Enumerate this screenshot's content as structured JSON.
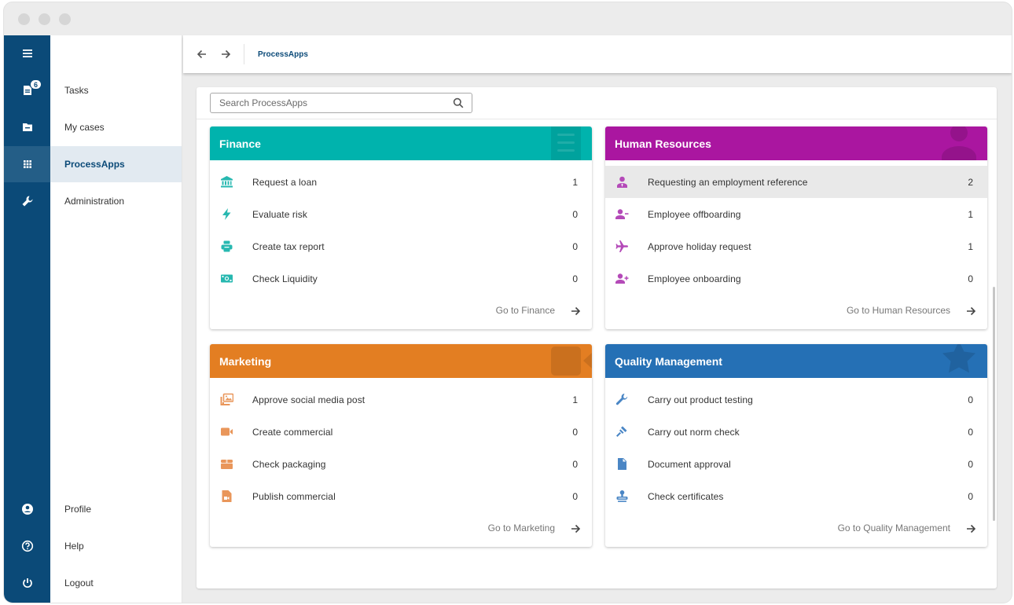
{
  "window": {
    "controls": [
      "close",
      "minimize",
      "maximize"
    ]
  },
  "rail": {
    "menu_icon": "hamburger-icon",
    "tasks_badge": "6",
    "items": [
      {
        "name": "tasks",
        "icon": "task-list-icon"
      },
      {
        "name": "my-cases",
        "icon": "folder-icon"
      },
      {
        "name": "processapps",
        "icon": "apps-grid-icon",
        "active": true
      },
      {
        "name": "administration",
        "icon": "wrench-icon"
      },
      {
        "name": "profile",
        "icon": "account-circle-icon"
      },
      {
        "name": "help",
        "icon": "help-circle-icon"
      },
      {
        "name": "logout",
        "icon": "power-icon"
      }
    ]
  },
  "nav": {
    "tasks": "Tasks",
    "my_cases": "My cases",
    "processapps": "ProcessApps",
    "administration": "Administration",
    "profile": "Profile",
    "help": "Help",
    "logout": "Logout"
  },
  "topbar": {
    "back_icon": "arrow-left-icon",
    "forward_icon": "arrow-right-icon",
    "title": "ProcessApps"
  },
  "search": {
    "placeholder": "Search ProcessApps",
    "value": ""
  },
  "cards": [
    {
      "title": "Finance",
      "color": "#00b3ad",
      "icon_color": "#27b8b0",
      "items": [
        {
          "label": "Request a loan",
          "count": "1",
          "icon": "bank-icon"
        },
        {
          "label": "Evaluate risk",
          "count": "0",
          "icon": "lightning-icon"
        },
        {
          "label": "Create tax report",
          "count": "0",
          "icon": "printer-icon"
        },
        {
          "label": "Check Liquidity",
          "count": "0",
          "icon": "cash-icon"
        }
      ],
      "link": "Go to Finance"
    },
    {
      "title": "Human Resources",
      "color": "#aa16a0",
      "icon_color": "#b44ab8",
      "items": [
        {
          "label": "Requesting an employment reference",
          "count": "2",
          "icon": "employee-tie-icon",
          "highlighted": true
        },
        {
          "label": "Employee offboarding",
          "count": "1",
          "icon": "person-remove-icon"
        },
        {
          "label": "Approve holiday request",
          "count": "1",
          "icon": "airplane-icon"
        },
        {
          "label": "Employee onboarding",
          "count": "0",
          "icon": "person-add-icon"
        }
      ],
      "link": "Go to Human Resources"
    },
    {
      "title": "Marketing",
      "color": "#e37e22",
      "icon_color": "#e9965a",
      "items": [
        {
          "label": "Approve social media post",
          "count": "1",
          "icon": "image-multiple-icon"
        },
        {
          "label": "Create commercial",
          "count": "0",
          "icon": "video-camera-icon"
        },
        {
          "label": "Check packaging",
          "count": "0",
          "icon": "package-icon"
        },
        {
          "label": "Publish commercial",
          "count": "0",
          "icon": "video-file-icon"
        }
      ],
      "link": "Go to Marketing"
    },
    {
      "title": "Quality Management",
      "color": "#2570b5",
      "icon_color": "#4a86c5",
      "items": [
        {
          "label": "Carry out product testing",
          "count": "0",
          "icon": "wrench-icon"
        },
        {
          "label": "Carry out norm check",
          "count": "0",
          "icon": "gavel-icon"
        },
        {
          "label": "Document approval",
          "count": "0",
          "icon": "document-icon"
        },
        {
          "label": "Check certificates",
          "count": "0",
          "icon": "stamp-icon"
        }
      ],
      "link": "Go to Quality Management"
    }
  ]
}
